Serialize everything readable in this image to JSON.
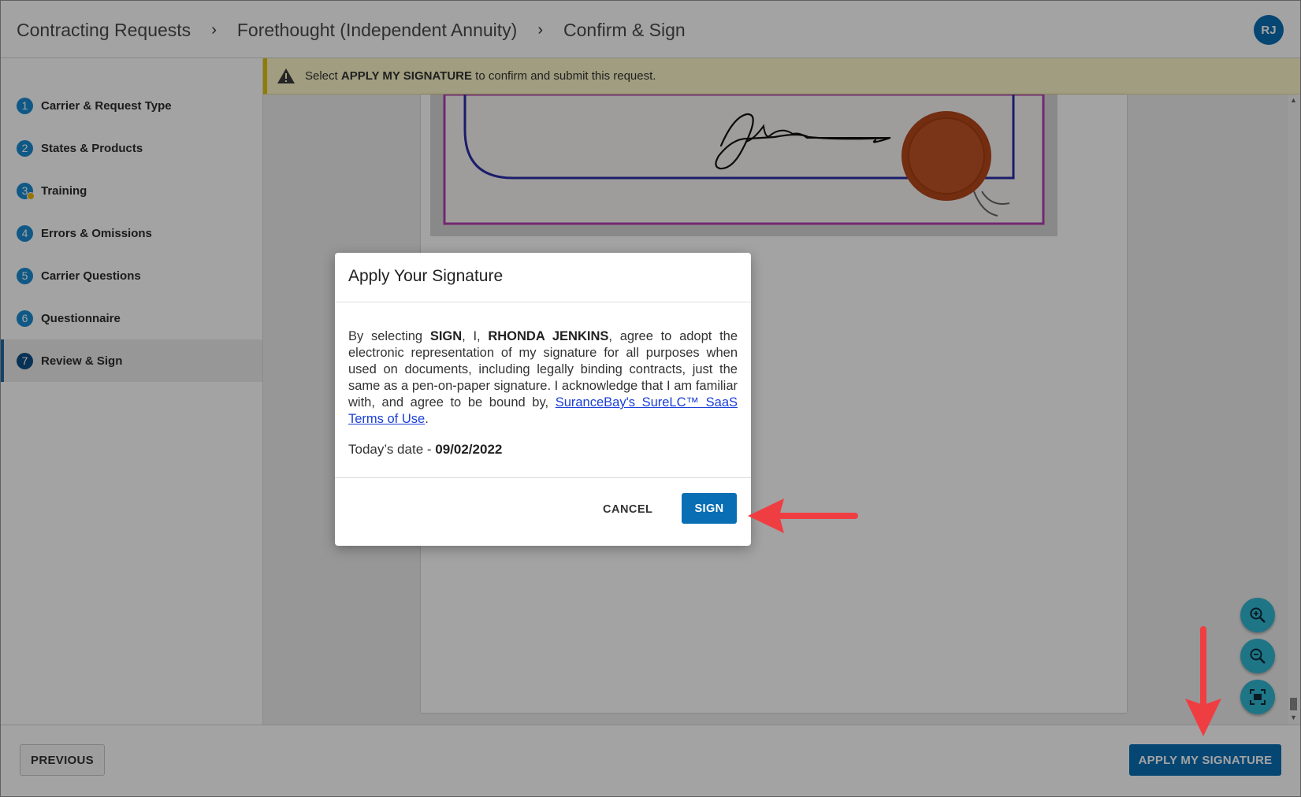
{
  "header": {
    "breadcrumbs": [
      "Contracting Requests",
      "Forethought (Independent Annuity)",
      "Confirm & Sign"
    ],
    "separator": "›",
    "avatar_initials": "RJ"
  },
  "sidebar": {
    "steps": [
      {
        "number": "1",
        "label": "Carrier & Request Type"
      },
      {
        "number": "2",
        "label": "States & Products"
      },
      {
        "number": "3",
        "label": "Training",
        "indicator": "warning-dot"
      },
      {
        "number": "4",
        "label": "Errors & Omissions"
      },
      {
        "number": "5",
        "label": "Carrier Questions"
      },
      {
        "number": "6",
        "label": "Questionnaire"
      },
      {
        "number": "7",
        "label": "Review & Sign",
        "active": true
      }
    ]
  },
  "banner": {
    "prefix": "Select ",
    "action": "APPLY MY SIGNATURE",
    "suffix": " to confirm and submit this request."
  },
  "modal": {
    "title": "Apply Your Signature",
    "body_1": "By selecting ",
    "body_sign": "SIGN",
    "body_2": ", I, ",
    "body_name": "RHONDA JENKINS",
    "body_3": ", agree to adopt the electronic representation of my signature for all purposes when used on documents, including legally binding contracts, just the same as a pen-on-paper signature. I acknowledge that I am familiar with, and agree to be bound by, ",
    "link_text": "SuranceBay's SureLC™ SaaS Terms of Use",
    "body_4": ".",
    "date_label": "Today’s date - ",
    "date_value": "09/02/2022",
    "cancel_label": "CANCEL",
    "sign_label": "SIGN"
  },
  "footer": {
    "previous_label": "PREVIOUS",
    "apply_label": "APPLY MY SIGNATURE"
  },
  "colors": {
    "primary": "#0a6eb4",
    "step_badge": "#1a8bd2",
    "banner_bg": "#fcf6c8",
    "zoom_button": "#30b8d2",
    "annotation_arrow": "#ef3e42",
    "seal": "#b5471b"
  }
}
